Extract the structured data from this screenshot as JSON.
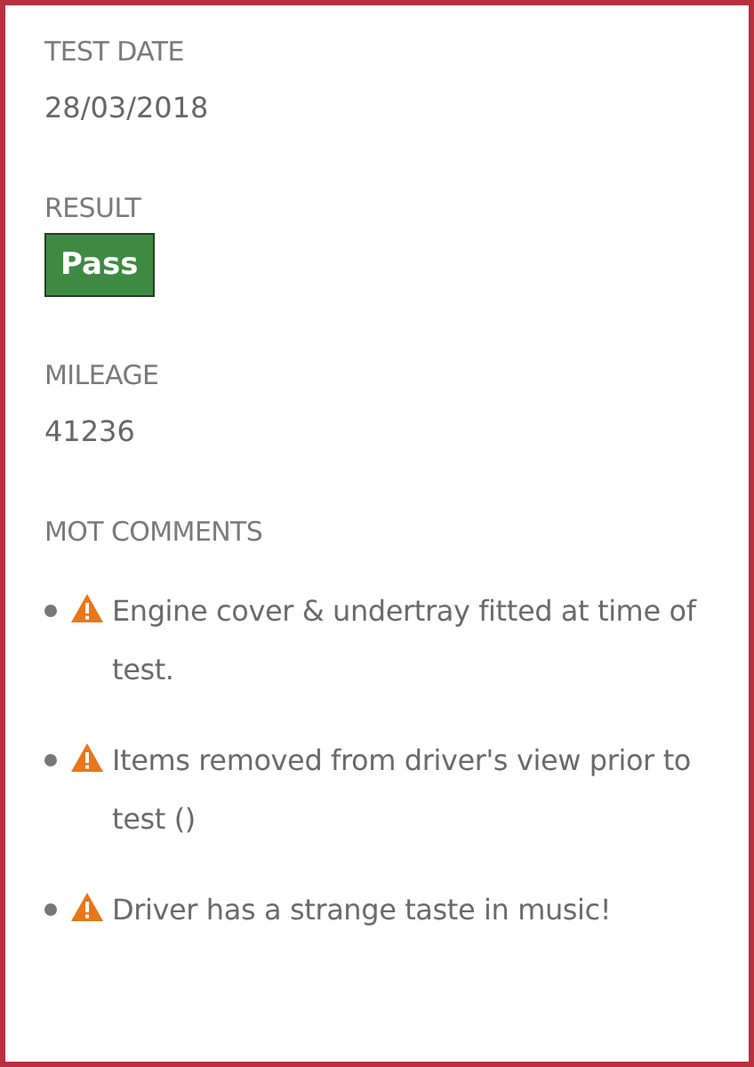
{
  "fields": [
    {
      "label": "TEST DATE",
      "kind": "text",
      "value": "28/03/2018"
    },
    {
      "label": "RESULT",
      "kind": "badge",
      "value": "Pass"
    },
    {
      "label": "MILEAGE",
      "kind": "text",
      "value": "41236"
    }
  ],
  "comments": {
    "label": "MOT COMMENTS",
    "items": [
      {
        "kind": "warning",
        "text": "Engine cover & undertray fitted at time of test."
      },
      {
        "kind": "warning",
        "text": "Items removed from driver's view prior to test ()"
      },
      {
        "kind": "warning",
        "text": "Driver has a strange taste in music!"
      }
    ]
  }
}
